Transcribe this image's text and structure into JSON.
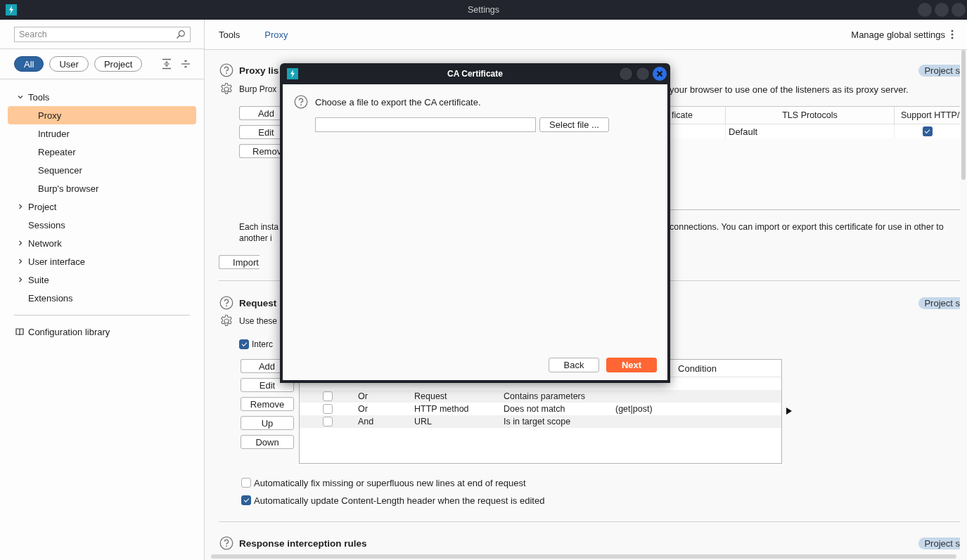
{
  "window": {
    "title": "Settings"
  },
  "sidebar": {
    "search": {
      "placeholder": "Search"
    },
    "filters": [
      {
        "label": "All",
        "selected": true
      },
      {
        "label": "User",
        "selected": false
      },
      {
        "label": "Project",
        "selected": false
      }
    ],
    "tree": [
      {
        "label": "Tools",
        "kind": "group",
        "expanded": true,
        "selected": false,
        "children": [
          {
            "label": "Proxy",
            "selected": true
          },
          {
            "label": "Intruder",
            "selected": false
          },
          {
            "label": "Repeater",
            "selected": false
          },
          {
            "label": "Sequencer",
            "selected": false
          },
          {
            "label": "Burp's browser",
            "selected": false
          }
        ]
      },
      {
        "label": "Project",
        "kind": "group",
        "expanded": false,
        "selected": false
      },
      {
        "label": "Sessions",
        "kind": "page",
        "selected": false
      },
      {
        "label": "Network",
        "kind": "group",
        "expanded": false,
        "selected": false
      },
      {
        "label": "User interface",
        "kind": "group",
        "expanded": false,
        "selected": false
      },
      {
        "label": "Suite",
        "kind": "group",
        "expanded": false,
        "selected": false
      },
      {
        "label": "Extensions",
        "kind": "page",
        "selected": false
      }
    ],
    "library_link": "Configuration library"
  },
  "main": {
    "breadcrumb": [
      {
        "label": "Tools",
        "selected": false
      },
      {
        "label": "Proxy",
        "selected": true
      }
    ],
    "manage_link": "Manage global settings",
    "proxy_listeners": {
      "title": "Proxy lis",
      "badge": "Project s",
      "description_start": "Burp Prox",
      "description_end": "your browser to use one of the listeners as its proxy server.",
      "buttons": [
        "Add",
        "Edit",
        "Remov"
      ],
      "table": {
        "columns": [
          "ficate",
          "TLS Protocols",
          "Support HTTP/"
        ],
        "rows": [
          {
            "tls_protocols": "Default",
            "support_checked": true
          }
        ]
      },
      "note_start": [
        "Each insta",
        "another i"
      ],
      "note_end": "connections. You can import or export this certificate for use in other to",
      "import_button": "Import"
    },
    "request_rules": {
      "title": "Request",
      "badge": "Project s",
      "description_start": "Use these",
      "intercept": {
        "label": "Interc",
        "checked": true
      },
      "buttons": [
        "Add",
        "Edit",
        "Remove",
        "Up",
        "Down"
      ],
      "table": {
        "condition_header": "Condition",
        "rows": [
          {
            "enabled": false,
            "operator": "Or",
            "match_type": "Request",
            "relationship": "Contains parameters"
          },
          {
            "enabled": false,
            "operator": "Or",
            "match_type": "HTTP method",
            "relationship": "Does not match",
            "condition": "(get|post)"
          },
          {
            "enabled": false,
            "operator": "And",
            "match_type": "URL",
            "relationship": "Is in target scope"
          }
        ]
      },
      "options": [
        {
          "label": "Automatically fix missing or superfluous new lines at end of request",
          "checked": false
        },
        {
          "label": "Automatically update Content-Length header when the request is edited",
          "checked": true
        }
      ]
    },
    "response_rules": {
      "title": "Response interception rules",
      "badge": "Project s"
    }
  },
  "dialog": {
    "title": "CA Certificate",
    "prompt": "Choose a file to export the CA certificate.",
    "select_button": "Select file ...",
    "buttons": [
      {
        "label": "Back",
        "kind": "secondary"
      },
      {
        "label": "Next",
        "kind": "primary"
      }
    ]
  }
}
